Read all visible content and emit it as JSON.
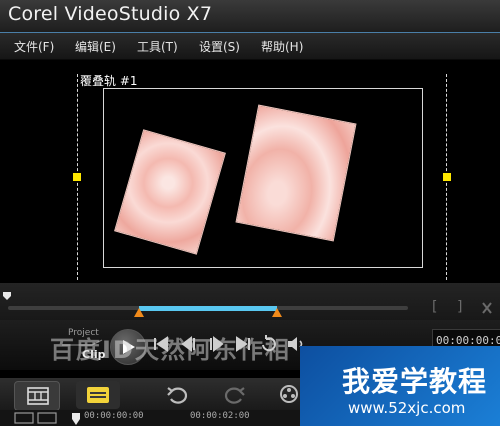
{
  "app": {
    "title": "Corel VideoStudio X7"
  },
  "menu": {
    "items": [
      "文件(F)",
      "编辑(E)",
      "工具(T)",
      "设置(S)",
      "帮助(H)"
    ]
  },
  "preview": {
    "overlay_label": "覆叠轨 #1"
  },
  "scrubber": {
    "mark_in": "[",
    "mark_out": "]"
  },
  "mode": {
    "project": "Project",
    "clip": "Clip",
    "selected": "Clip"
  },
  "playback": {
    "timecode": "00:00:00:00"
  },
  "watermark": {
    "text": "百度ID天然阿东作相"
  },
  "timeline": {
    "ruler": [
      "00:00:00:00",
      "00:00:02:00"
    ]
  },
  "logo": {
    "name": "我爱学教程",
    "url": "www.52xjc.com"
  },
  "colors": {
    "accent": "#59c7f0",
    "trim_marker": "#f08a1a",
    "handle": "#ffe800",
    "logo_bg": "#1565c0"
  }
}
